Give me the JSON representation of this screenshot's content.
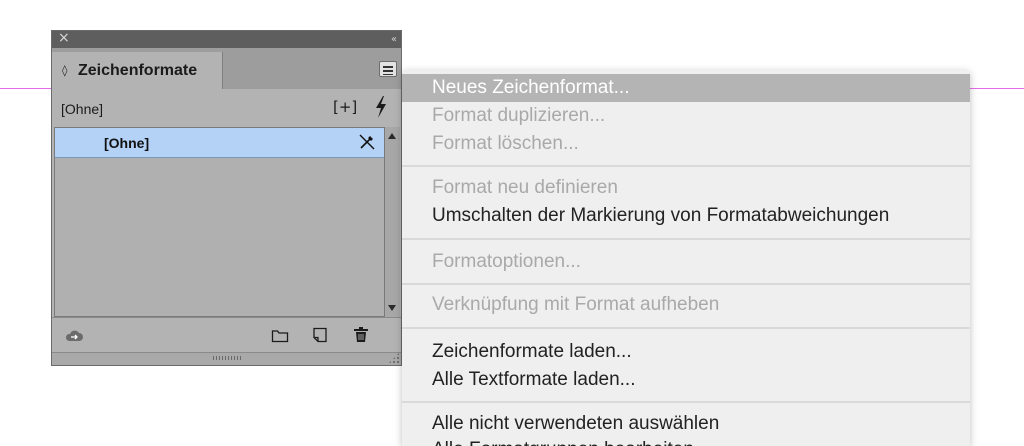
{
  "panel": {
    "tab_label": "Zeichenformate",
    "current_style": "[Ohne]",
    "list": [
      {
        "label": "[Ohne]",
        "selected": true
      }
    ]
  },
  "menu": {
    "items": [
      {
        "label": "Neues Zeichenformat...",
        "state": "highlight"
      },
      {
        "label": "Format duplizieren...",
        "state": "disabled"
      },
      {
        "label": "Format löschen...",
        "state": "disabled"
      },
      {
        "label": "Format neu definieren",
        "state": "disabled"
      },
      {
        "label": "Umschalten der Markierung von Formatabweichungen",
        "state": "enabled"
      },
      {
        "label": "Formatoptionen...",
        "state": "disabled"
      },
      {
        "label": "Verknüpfung mit Format aufheben",
        "state": "disabled"
      },
      {
        "label": "Zeichenformate laden...",
        "state": "enabled"
      },
      {
        "label": "Alle Textformate laden...",
        "state": "enabled"
      },
      {
        "label": "Alle nicht verwendeten auswählen",
        "state": "enabled"
      },
      {
        "label": "Alle Formatgruppen bearbeiten...",
        "state": "enabled"
      }
    ]
  },
  "colors": {
    "guide": "#e66be6",
    "selection": "#b3d2f6",
    "menu_highlight": "#b4b4b4"
  }
}
